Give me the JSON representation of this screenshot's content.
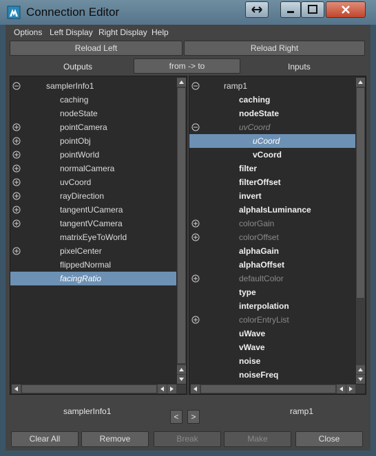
{
  "window": {
    "title": "Connection Editor"
  },
  "menu": [
    "Options",
    "Left Display",
    "Right Display",
    "Help"
  ],
  "reload": {
    "left": "Reload Left",
    "right": "Reload Right"
  },
  "columns": {
    "outputs": "Outputs",
    "direction": "from -> to",
    "inputs": "Inputs"
  },
  "left_list": [
    {
      "text": "samplerInfo1",
      "indent": 0,
      "expander": "minus",
      "style": "node"
    },
    {
      "text": "caching",
      "indent": 1,
      "expander": "",
      "style": "normal"
    },
    {
      "text": "nodeState",
      "indent": 1,
      "expander": "",
      "style": "normal"
    },
    {
      "text": "pointCamera",
      "indent": 1,
      "expander": "plus",
      "style": "normal"
    },
    {
      "text": "pointObj",
      "indent": 1,
      "expander": "plus",
      "style": "normal"
    },
    {
      "text": "pointWorld",
      "indent": 1,
      "expander": "plus",
      "style": "normal"
    },
    {
      "text": "normalCamera",
      "indent": 1,
      "expander": "plus",
      "style": "normal"
    },
    {
      "text": "uvCoord",
      "indent": 1,
      "expander": "plus",
      "style": "normal"
    },
    {
      "text": "rayDirection",
      "indent": 1,
      "expander": "plus",
      "style": "normal"
    },
    {
      "text": "tangentUCamera",
      "indent": 1,
      "expander": "plus",
      "style": "normal"
    },
    {
      "text": "tangentVCamera",
      "indent": 1,
      "expander": "plus",
      "style": "normal"
    },
    {
      "text": "matrixEyeToWorld",
      "indent": 1,
      "expander": "",
      "style": "normal"
    },
    {
      "text": "pixelCenter",
      "indent": 1,
      "expander": "plus",
      "style": "normal"
    },
    {
      "text": "flippedNormal",
      "indent": 1,
      "expander": "",
      "style": "normal"
    },
    {
      "text": "facingRatio",
      "indent": 1,
      "expander": "",
      "style": "selected"
    }
  ],
  "right_list": [
    {
      "text": "ramp1",
      "indent": 0,
      "expander": "minus",
      "style": "node"
    },
    {
      "text": "caching",
      "indent": 1,
      "expander": "",
      "style": "bold"
    },
    {
      "text": "nodeState",
      "indent": 1,
      "expander": "",
      "style": "bold"
    },
    {
      "text": "uvCoord",
      "indent": 1,
      "expander": "minus",
      "style": "dim-italic"
    },
    {
      "text": "uCoord",
      "indent": 2,
      "expander": "",
      "style": "selected"
    },
    {
      "text": "vCoord",
      "indent": 2,
      "expander": "",
      "style": "bold"
    },
    {
      "text": "filter",
      "indent": 1,
      "expander": "",
      "style": "bold"
    },
    {
      "text": "filterOffset",
      "indent": 1,
      "expander": "",
      "style": "bold"
    },
    {
      "text": "invert",
      "indent": 1,
      "expander": "",
      "style": "bold"
    },
    {
      "text": "alphaIsLuminance",
      "indent": 1,
      "expander": "",
      "style": "bold"
    },
    {
      "text": "colorGain",
      "indent": 1,
      "expander": "plus",
      "style": "dim"
    },
    {
      "text": "colorOffset",
      "indent": 1,
      "expander": "plus",
      "style": "dim"
    },
    {
      "text": "alphaGain",
      "indent": 1,
      "expander": "",
      "style": "bold"
    },
    {
      "text": "alphaOffset",
      "indent": 1,
      "expander": "",
      "style": "bold"
    },
    {
      "text": "defaultColor",
      "indent": 1,
      "expander": "plus",
      "style": "dim"
    },
    {
      "text": "type",
      "indent": 1,
      "expander": "",
      "style": "bold"
    },
    {
      "text": "interpolation",
      "indent": 1,
      "expander": "",
      "style": "bold"
    },
    {
      "text": "colorEntryList",
      "indent": 1,
      "expander": "plus",
      "style": "dim"
    },
    {
      "text": "uWave",
      "indent": 1,
      "expander": "",
      "style": "bold"
    },
    {
      "text": "vWave",
      "indent": 1,
      "expander": "",
      "style": "bold"
    },
    {
      "text": "noise",
      "indent": 1,
      "expander": "",
      "style": "bold"
    },
    {
      "text": "noiseFreq",
      "indent": 1,
      "expander": "",
      "style": "bold"
    }
  ],
  "footer": {
    "left_node": "samplerInfo1",
    "right_node": "ramp1",
    "prev": "<",
    "next": ">"
  },
  "buttons": [
    {
      "label": "Clear All",
      "enabled": true
    },
    {
      "label": "Remove",
      "enabled": true
    },
    {
      "label": "Break",
      "enabled": false
    },
    {
      "label": "Make",
      "enabled": false
    },
    {
      "label": "Close",
      "enabled": true
    }
  ],
  "colors": {
    "selection": "#6d91b4",
    "panel": "#2b2b2b",
    "window": "#444444",
    "titlebar": "#6f8ea1"
  },
  "icons": {
    "app": "maya-app-icon",
    "restore": "swap-arrows-icon",
    "minimize": "minimize-icon",
    "maximize": "maximize-icon",
    "close": "close-icon"
  }
}
